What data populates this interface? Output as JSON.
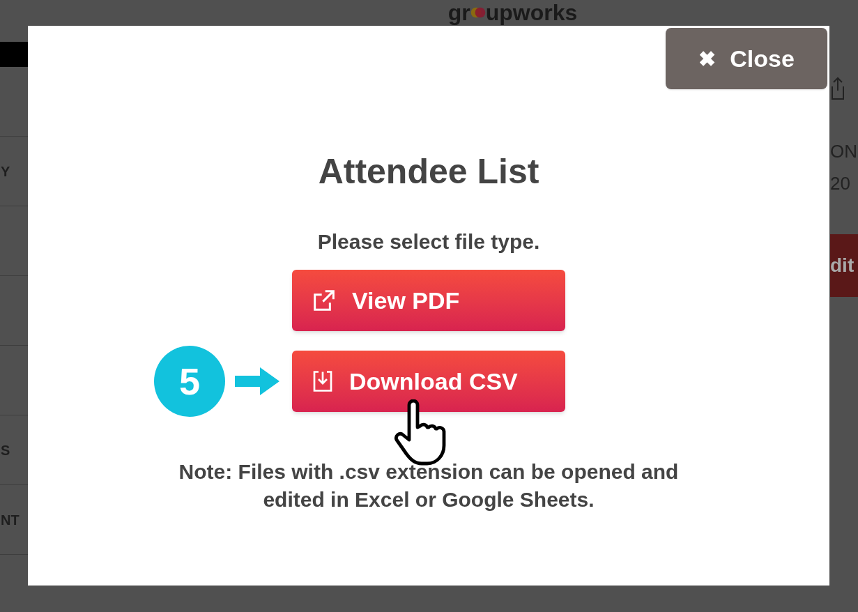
{
  "background": {
    "logo": {
      "prefix": "gr",
      "suffix": "upworks"
    },
    "sidebar_fragments": [
      "Y",
      "S",
      "NT"
    ],
    "right_fragments": [
      "ON",
      "20"
    ],
    "right_button": "dit"
  },
  "dialog": {
    "close_button": {
      "icon": "✖",
      "label": "Close"
    },
    "title": "Attendee List",
    "prompt": "Please select file type.",
    "buttons": [
      {
        "kind": "view",
        "label": "View PDF",
        "highlighted": false
      },
      {
        "kind": "download",
        "label": "Download CSV",
        "highlighted": true
      }
    ],
    "step": "5",
    "note": "Note: Files with .csv extension can be opened and edited in Excel or Google Sheets."
  }
}
